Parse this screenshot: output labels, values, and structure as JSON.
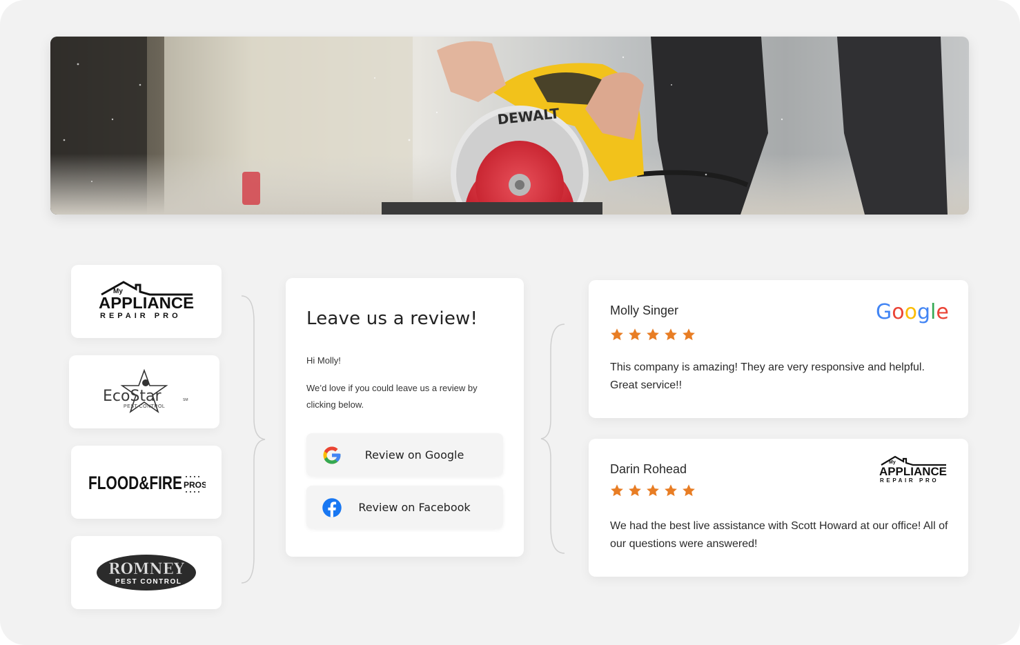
{
  "logos": {
    "appliance": {
      "my": "My",
      "main": "APPLIANCE",
      "sub": "REPAIR PRO"
    },
    "ecostar": {
      "main": "EcoStar",
      "sub": "PEST CONTROL",
      "tm": "SM"
    },
    "flood": {
      "main": "FLOOD&FIRE",
      "suffix": "PROS"
    },
    "romney": {
      "main": "ROMNEY",
      "sub": "PEST CONTROL"
    }
  },
  "hero": {
    "brand_on_tool": "DEWALT"
  },
  "request": {
    "title": "Leave us a review!",
    "greeting": "Hi Molly!",
    "message": "We’d love if you could leave us a review by clicking below.",
    "google_button": "Review on Google",
    "facebook_button": "Review on Facebook"
  },
  "testimonials": [
    {
      "name": "Molly Singer",
      "rating": 5,
      "text": "This company is amazing! They are very responsive and helpful. Great service!!",
      "source": "Google"
    },
    {
      "name": "Darin Rohead",
      "rating": 5,
      "text": "We had the best live assistance with Scott Howard at our office! All of our questions were answered!",
      "source_logo": {
        "my": "My",
        "main": "APPLIANCE",
        "sub": "REPAIR PRO"
      }
    }
  ],
  "colors": {
    "star": "#e87d24",
    "google_blue": "#4285F4",
    "google_red": "#EA4335",
    "google_yellow": "#FBBC05",
    "google_green": "#34A853",
    "facebook": "#1877F2",
    "saw_yellow": "#f2c21b",
    "blade_red": "#d9323c"
  },
  "icons": {
    "google": "google-g-icon",
    "facebook": "facebook-f-icon",
    "star": "star-icon"
  }
}
